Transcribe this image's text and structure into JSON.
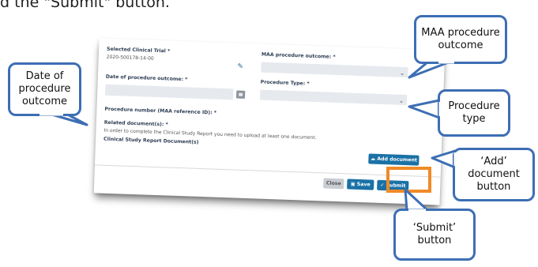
{
  "intro_text": "d the \"Submit\" button.",
  "form": {
    "selected_trial_label": "Selected Clinical Trial *",
    "selected_trial_value": "2020-500178-14-00",
    "maa_outcome_label": "MAA procedure outcome: *",
    "date_label": "Date of procedure outcome: *",
    "procedure_type_label": "Procedure Type: *",
    "procedure_number_label": "Procedure number (MAA reference ID): *",
    "related_docs_label": "Related document(s): *",
    "related_docs_hint": "In order to complete the Clinical Study Report you need to upload at least one document.",
    "csr_docs_label": "Clinical Study Report Document(s)",
    "add_document_label": "Add document",
    "close_label": "Close",
    "save_label": "Save",
    "submit_label": "Submit"
  },
  "callouts": {
    "maa": "MAA procedure outcome",
    "date": "Date of procedure outcome",
    "type": "Procedure type",
    "add": "‘Add’ document button",
    "submit": "‘Submit’ button"
  },
  "icons": {
    "edit": "pencil-icon",
    "calendar": "calendar-icon",
    "dropdown": "chevron-down-icon",
    "upload": "cloud-upload-icon",
    "save": "floppy-disk-icon",
    "submit": "checkmark-icon"
  },
  "colors": {
    "callout_border": "#3d6eb4",
    "highlight": "#f08a28",
    "primary_button": "#1a71a6"
  }
}
